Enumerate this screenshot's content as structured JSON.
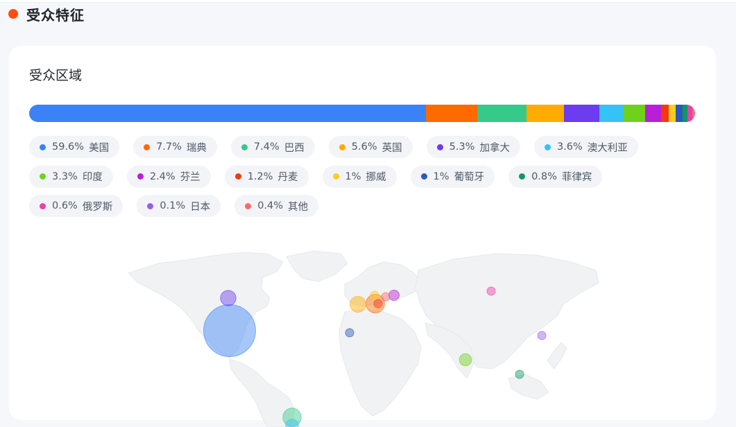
{
  "section": {
    "title": "受众特征",
    "dot_color": "#ff4d12"
  },
  "card": {
    "title": "受众区域"
  },
  "chart_data": {
    "type": "bar",
    "stacked": true,
    "title": "受众区域",
    "categories": [
      "美国",
      "瑞典",
      "巴西",
      "英国",
      "加拿大",
      "澳大利亚",
      "印度",
      "芬兰",
      "丹麦",
      "挪威",
      "葡萄牙",
      "菲律宾",
      "俄罗斯",
      "日本",
      "其他"
    ],
    "values": [
      59.6,
      7.7,
      7.4,
      5.6,
      5.3,
      3.6,
      3.3,
      2.4,
      1.2,
      1,
      1,
      0.8,
      0.6,
      0.1,
      0.4
    ],
    "labels": [
      "59.6%",
      "7.7%",
      "7.4%",
      "5.6%",
      "5.3%",
      "3.6%",
      "3.3%",
      "2.4%",
      "1.2%",
      "1%",
      "1%",
      "0.8%",
      "0.6%",
      "0.1%",
      "0.4%"
    ],
    "colors": [
      "#3b82f6",
      "#ff6a00",
      "#36c98a",
      "#ffab00",
      "#6c3cf0",
      "#33c3f5",
      "#6fd11a",
      "#b81fd6",
      "#f5380f",
      "#ffcd1f",
      "#2a59b8",
      "#129661",
      "#ee3ea9",
      "#9a5cf0",
      "#f86b6b"
    ],
    "legend_rows": [
      [
        0,
        1,
        2,
        3,
        4,
        5
      ],
      [
        6,
        7,
        8,
        9,
        10,
        11
      ],
      [
        12,
        13,
        14
      ]
    ]
  }
}
